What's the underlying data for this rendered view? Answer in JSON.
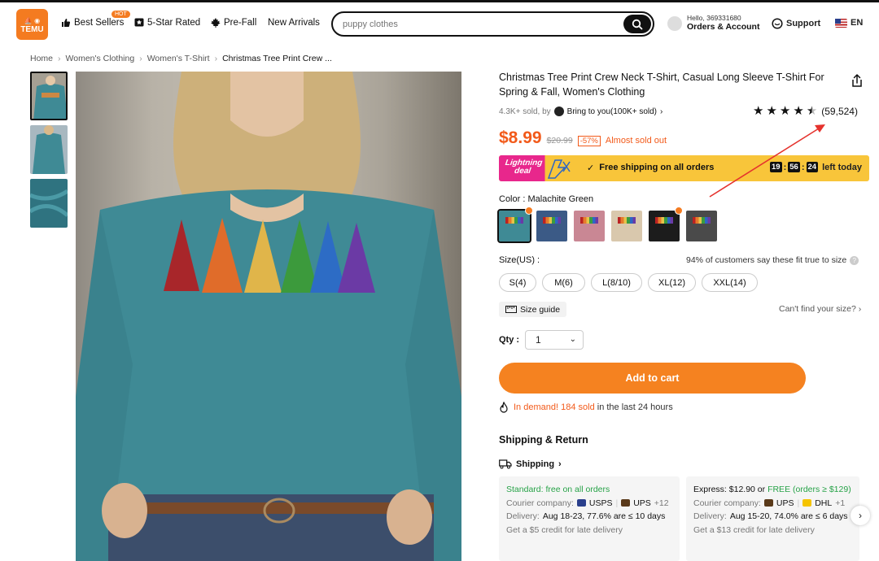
{
  "header": {
    "logo_top": "⛵ ◉",
    "logo_text": "TEMU",
    "nav": [
      {
        "label": "Best Sellers",
        "badge": "HOT"
      },
      {
        "label": "5-Star Rated"
      },
      {
        "label": "Pre-Fall"
      },
      {
        "label": "New Arrivals"
      }
    ],
    "search_placeholder": "puppy clothes",
    "account_greeting": "Hello, 369331680",
    "account_label": "Orders & Account",
    "support_label": "Support",
    "language": "EN",
    "brand_color": "#f47b20"
  },
  "breadcrumb": [
    "Home",
    "Women's Clothing",
    "Women's T-Shirt",
    "Christmas Tree Print Crew ..."
  ],
  "product": {
    "title": "Christmas Tree Print Crew Neck T-Shirt, Casual Long Sleeve T-Shirt For Spring & Fall, Women's Clothing",
    "sold_text": "4.3K+ sold, by",
    "store_text": "Bring to you(100K+ sold)",
    "rating_stars": 4.5,
    "rating_count": "(59,524)",
    "price": "$8.99",
    "original_price": "$20.99",
    "discount": "-57%",
    "stock_note": "Almost sold out",
    "lightning_label_1": "Lightning",
    "lightning_label_2": "deal",
    "free_shipping": "Free shipping on all orders",
    "timer": [
      "19",
      "56",
      "24"
    ],
    "timer_suffix": "left today",
    "color_label": "Color : Malachite Green",
    "colors": [
      {
        "name": "Malachite Green",
        "hex": "#3f8a95",
        "selected": true,
        "hot": true
      },
      {
        "name": "Blue",
        "hex": "#3b5a86"
      },
      {
        "name": "Pink",
        "hex": "#c98794"
      },
      {
        "name": "Apricot",
        "hex": "#d9c8ad"
      },
      {
        "name": "Black",
        "hex": "#1c1c1c",
        "hot": true
      },
      {
        "name": "Dark Grey",
        "hex": "#4a4a4a"
      }
    ],
    "size_label": "Size(US) :",
    "fit_note": "94% of customers say these fit true to size",
    "sizes": [
      "S(4)",
      "M(6)",
      "L(8/10)",
      "XL(12)",
      "XXL(14)"
    ],
    "size_guide": "Size guide",
    "cant_find": "Can't find your size? ›",
    "qty_label": "Qty :",
    "qty_value": "1",
    "add_to_cart": "Add to cart",
    "demand_hl": "In demand! 184 sold",
    "demand_rest": "in the last 24 hours"
  },
  "shipping": {
    "title": "Shipping & Return",
    "link": "Shipping",
    "standard": {
      "headline": "Standard: free on all orders",
      "courier_label": "Courier company:",
      "couriers": [
        "USPS",
        "UPS",
        "+12"
      ],
      "delivery_label": "Delivery:",
      "delivery": "Aug 18-23, 77.6% are ≤ 10 days",
      "credit": "Get a $5 credit for late delivery"
    },
    "express": {
      "headline_a": "Express: $12.90 or ",
      "headline_b": "FREE (orders ≥ $129)",
      "courier_label": "Courier company:",
      "couriers": [
        "UPS",
        "DHL",
        "+1"
      ],
      "delivery_label": "Delivery:",
      "delivery": "Aug 15-20, 74.0% are ≤ 6 days",
      "credit": "Get a $13 credit for late delivery"
    }
  }
}
